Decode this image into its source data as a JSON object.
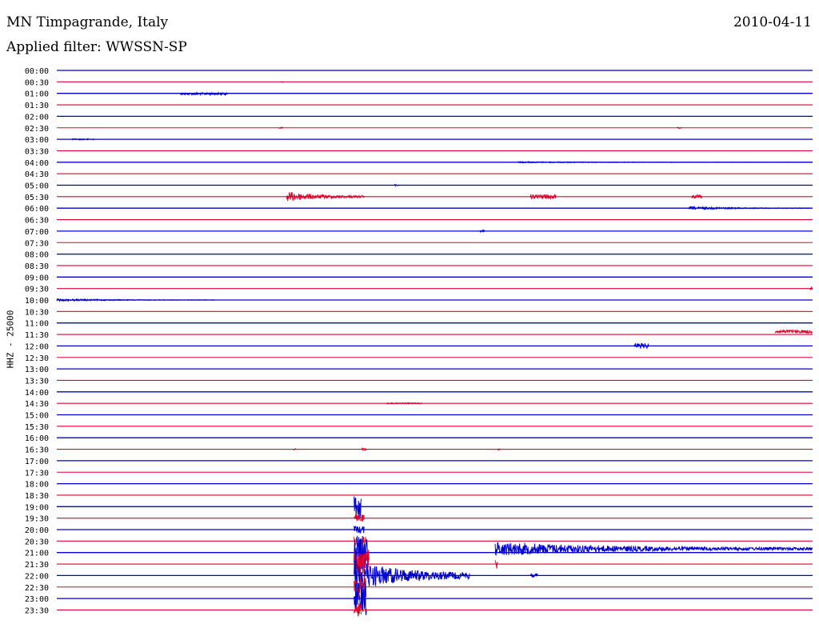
{
  "header": {
    "title": "MN Timpagrande, Italy",
    "date": "2010-04-11",
    "filter": "Applied filter: WWSSN-SP"
  },
  "colors": {
    "even_line": "#0000cc",
    "odd_line": "#e0002a",
    "text": "#000000",
    "background": "#ffffff"
  },
  "chart_data": {
    "type": "line",
    "title": "MN Timpagrande, Italy",
    "subtitle": "Applied filter: WWSSN-SP",
    "date": "2010-04-11",
    "ylabel": "HHZ  -  25000",
    "xlabel": "",
    "row_interval_minutes": 30,
    "grid": false,
    "rows": [
      {
        "label": "00:00",
        "color": "#0000cc",
        "events": []
      },
      {
        "label": "00:30",
        "color": "#e0002a",
        "events": [
          {
            "minute": 8.9,
            "amplitude": 0.4,
            "duration": 0.1
          }
        ]
      },
      {
        "label": "01:00",
        "color": "#0000cc",
        "events": [
          {
            "minute": 4.9,
            "amplitude": 0.9,
            "duration": 1.9,
            "offset": 0.1
          }
        ]
      },
      {
        "label": "01:30",
        "color": "#e0002a",
        "events": []
      },
      {
        "label": "02:00",
        "color": "#0000cc",
        "events": []
      },
      {
        "label": "02:30",
        "color": "#e0002a",
        "events": [
          {
            "minute": 8.8,
            "amplitude": 0.6,
            "duration": 0.2
          },
          {
            "minute": 24.6,
            "amplitude": 0.6,
            "duration": 0.2
          }
        ]
      },
      {
        "label": "03:00",
        "color": "#0000cc",
        "events": [
          {
            "minute": 0.6,
            "amplitude": 0.5,
            "duration": 0.9
          }
        ]
      },
      {
        "label": "03:30",
        "color": "#e0002a",
        "events": []
      },
      {
        "label": "04:00",
        "color": "#0000cc",
        "events": [
          {
            "minute": 18.3,
            "amplitude": 0.6,
            "duration": 11.7
          }
        ]
      },
      {
        "label": "04:30",
        "color": "#e0002a",
        "events": []
      },
      {
        "label": "05:00",
        "color": "#0000cc",
        "events": [
          {
            "minute": 13.4,
            "amplitude": 0.6,
            "duration": 0.2
          }
        ]
      },
      {
        "label": "05:30",
        "color": "#e0002a",
        "events": [
          {
            "minute": 9.1,
            "amplitude": 4.5,
            "duration": 3.1
          },
          {
            "minute": 18.8,
            "amplitude": 2.0,
            "duration": 1.0
          },
          {
            "minute": 25.2,
            "amplitude": 1.5,
            "duration": 0.4
          }
        ]
      },
      {
        "label": "06:00",
        "color": "#0000cc",
        "events": [
          {
            "minute": 25.1,
            "amplitude": 1.3,
            "duration": 4.8
          }
        ]
      },
      {
        "label": "06:30",
        "color": "#e0002a",
        "events": []
      },
      {
        "label": "07:00",
        "color": "#0000cc",
        "events": [
          {
            "minute": 16.8,
            "amplitude": 0.8,
            "duration": 0.2
          }
        ]
      },
      {
        "label": "07:30",
        "color": "#e0002a",
        "events": []
      },
      {
        "label": "08:00",
        "color": "#0000cc",
        "events": []
      },
      {
        "label": "08:30",
        "color": "#e0002a",
        "events": []
      },
      {
        "label": "09:00",
        "color": "#0000cc",
        "events": []
      },
      {
        "label": "09:30",
        "color": "#e0002a",
        "events": [
          {
            "minute": 29.9,
            "amplitude": 1.5,
            "duration": 0.1
          }
        ]
      },
      {
        "label": "10:00",
        "color": "#0000cc",
        "events": [
          {
            "minute": 0.0,
            "amplitude": 1.0,
            "duration": 6.3
          }
        ]
      },
      {
        "label": "10:30",
        "color": "#e0002a",
        "events": []
      },
      {
        "label": "11:00",
        "color": "#0000cc",
        "events": []
      },
      {
        "label": "11:30",
        "color": "#e0002a",
        "events": [
          {
            "minute": 28.5,
            "amplitude": 1.3,
            "duration": 1.5,
            "offset": -0.6
          }
        ]
      },
      {
        "label": "12:00",
        "color": "#0000cc",
        "events": [
          {
            "minute": 22.9,
            "amplitude": 2.2,
            "duration": 0.6
          }
        ]
      },
      {
        "label": "12:30",
        "color": "#e0002a",
        "events": []
      },
      {
        "label": "13:00",
        "color": "#0000cc",
        "events": []
      },
      {
        "label": "13:30",
        "color": "#e0002a",
        "events": []
      },
      {
        "label": "14:00",
        "color": "#0000cc",
        "events": []
      },
      {
        "label": "14:30",
        "color": "#e0002a",
        "events": [
          {
            "minute": 13.1,
            "amplitude": 0.5,
            "duration": 1.4
          }
        ]
      },
      {
        "label": "15:00",
        "color": "#0000cc",
        "events": []
      },
      {
        "label": "15:30",
        "color": "#e0002a",
        "events": []
      },
      {
        "label": "16:00",
        "color": "#0000cc",
        "events": []
      },
      {
        "label": "16:30",
        "color": "#e0002a",
        "events": [
          {
            "minute": 9.4,
            "amplitude": 0.6,
            "duration": 0.1
          },
          {
            "minute": 12.1,
            "amplitude": 0.8,
            "duration": 0.2
          },
          {
            "minute": 17.5,
            "amplitude": 0.6,
            "duration": 0.1
          }
        ]
      },
      {
        "label": "17:00",
        "color": "#0000cc",
        "events": []
      },
      {
        "label": "17:30",
        "color": "#e0002a",
        "events": []
      },
      {
        "label": "18:00",
        "color": "#0000cc",
        "events": []
      },
      {
        "label": "18:30",
        "color": "#e0002a",
        "events": []
      },
      {
        "label": "19:00",
        "color": "#0000cc",
        "events": [
          {
            "minute": 11.8,
            "amplitude": 12.0,
            "duration": 0.3
          }
        ]
      },
      {
        "label": "19:30",
        "color": "#e0002a",
        "events": [
          {
            "minute": 11.8,
            "amplitude": 3.0,
            "duration": 0.4
          }
        ]
      },
      {
        "label": "20:00",
        "color": "#0000cc",
        "events": [
          {
            "minute": 11.8,
            "amplitude": 3.0,
            "duration": 0.4
          }
        ]
      },
      {
        "label": "20:30",
        "color": "#e0002a",
        "events": [
          {
            "minute": 11.8,
            "amplitude": 4.0,
            "duration": 0.5
          }
        ]
      },
      {
        "label": "21:00",
        "color": "#0000cc",
        "events": [
          {
            "minute": 11.8,
            "amplitude": 14.0,
            "duration": 0.6
          },
          {
            "minute": 17.4,
            "amplitude": 6.0,
            "duration": 12.6,
            "offset": -0.8
          }
        ]
      },
      {
        "label": "21:30",
        "color": "#e0002a",
        "events": [
          {
            "minute": 11.8,
            "amplitude": 12.0,
            "duration": 0.6
          },
          {
            "minute": 17.4,
            "amplitude": 5.0,
            "duration": 0.1
          }
        ]
      },
      {
        "label": "22:00",
        "color": "#0000cc",
        "events": [
          {
            "minute": 11.8,
            "amplitude": 14.0,
            "duration": 4.6
          },
          {
            "minute": 18.8,
            "amplitude": 1.5,
            "duration": 0.3
          }
        ]
      },
      {
        "label": "22:30",
        "color": "#e0002a",
        "events": [
          {
            "minute": 11.8,
            "amplitude": 10.0,
            "duration": 0.5
          }
        ]
      },
      {
        "label": "23:00",
        "color": "#0000cc",
        "events": [
          {
            "minute": 11.8,
            "amplitude": 14.0,
            "duration": 0.5
          }
        ]
      },
      {
        "label": "23:30",
        "color": "#e0002a",
        "events": [
          {
            "minute": 11.8,
            "amplitude": 6.0,
            "duration": 0.3
          }
        ]
      }
    ]
  }
}
